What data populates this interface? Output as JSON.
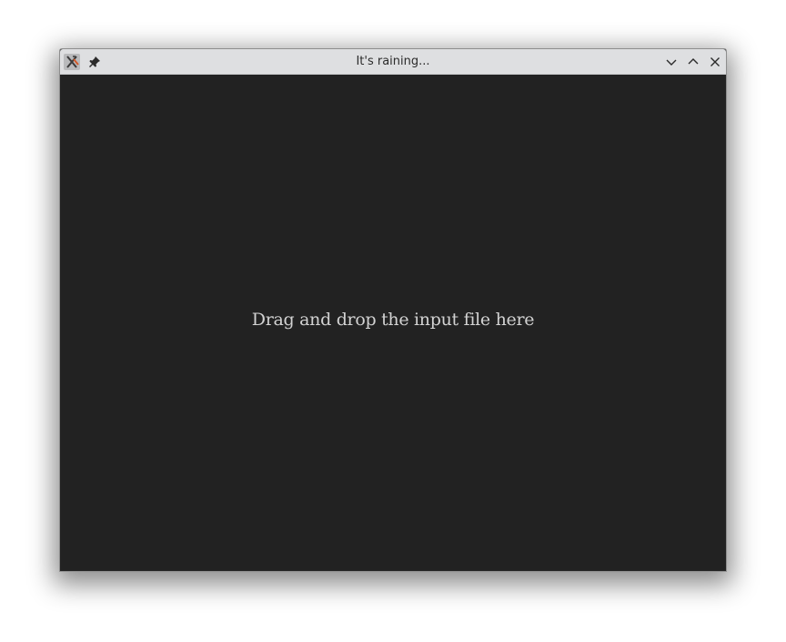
{
  "window": {
    "title": "It's raining..."
  },
  "titlebar": {
    "icons": [
      "app-icon",
      "pin-icon",
      "minimize-icon",
      "maximize-icon",
      "close-icon"
    ]
  },
  "content": {
    "drop_hint": "Drag and drop the input file here"
  },
  "colors": {
    "titlebar_bg": "#dedfe1",
    "content_bg": "#222222",
    "text_light": "#d2d2d2"
  }
}
